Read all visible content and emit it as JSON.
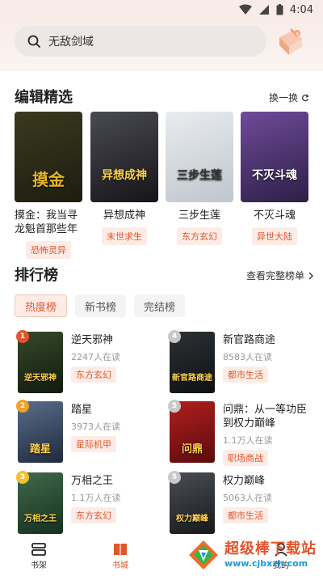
{
  "status": {
    "time": "4:04"
  },
  "search": {
    "query": "无敌剑域"
  },
  "editor_picks": {
    "title": "编辑精选",
    "refresh_label": "换一换",
    "books": [
      {
        "name": "摸金：我当寻龙魁首那些年",
        "tag": "恐怖灵异",
        "cover_text": "摸金",
        "colors": [
          "#3b3a1f",
          "#1d1c10"
        ],
        "accent": "#e8b623"
      },
      {
        "name": "异想成神",
        "tag": "末世求生",
        "cover_text": "异想成神",
        "colors": [
          "#4a4a52",
          "#151519"
        ],
        "accent": "#ffd24a"
      },
      {
        "name": "三步生莲",
        "tag": "东方玄幻",
        "cover_text": "三步生莲",
        "colors": [
          "#e9ecef",
          "#bfc6cc"
        ],
        "accent": "#333333"
      },
      {
        "name": "不灭斗魂",
        "tag": "异世大陆",
        "cover_text": "不灭斗魂",
        "colors": [
          "#6f4a9a",
          "#2d1f46"
        ],
        "accent": "#ffffff"
      }
    ]
  },
  "ranking": {
    "title": "排行榜",
    "view_all_label": "查看完整榜单",
    "tabs": [
      "热度榜",
      "新书榜",
      "完结榜"
    ],
    "active_tab": 0,
    "items": [
      {
        "rank": "1",
        "title": "逆天邪神",
        "readers": "2247人在读",
        "tag": "东方玄幻",
        "cover_text": "逆天邪神",
        "colors": [
          "#354a2a",
          "#121a0e"
        ],
        "badge": "#e2552b"
      },
      {
        "rank": "4",
        "title": "新官路商途",
        "readers": "8583人在读",
        "tag": "都市生活",
        "cover_text": "新官路商途",
        "colors": [
          "#2d3236",
          "#0e1012"
        ],
        "badge": "#c9c9c9"
      },
      {
        "rank": "2",
        "title": "踏星",
        "readers": "3973人在读",
        "tag": "星际机甲",
        "cover_text": "踏星",
        "colors": [
          "#5a6d8a",
          "#1f2a3d"
        ],
        "badge": "#f2a02b"
      },
      {
        "rank": "5",
        "title": "问鼎：从一等功臣到权力巅峰",
        "readers": "1.1万人在读",
        "tag": "职场商战",
        "cover_text": "问鼎",
        "colors": [
          "#b21e1e",
          "#5a0c0c"
        ],
        "badge": "#c9c9c9"
      },
      {
        "rank": "3",
        "title": "万相之王",
        "readers": "1.1万人在读",
        "tag": "东方玄幻",
        "cover_text": "万相之王",
        "colors": [
          "#3f6a4a",
          "#173020"
        ],
        "badge": "#f2c12b"
      },
      {
        "rank": "5",
        "title": "权力巅峰",
        "readers": "5063人在读",
        "tag": "都市生活",
        "cover_text": "权力巅峰",
        "colors": [
          "#4b4f55",
          "#16181b"
        ],
        "badge": "#c9c9c9"
      }
    ]
  },
  "bottom_nav": {
    "items": [
      {
        "label": "书架",
        "icon": "bookshelf-icon"
      },
      {
        "label": "书城",
        "icon": "bookstore-icon"
      },
      {
        "label": "我的",
        "icon": "profile-icon"
      }
    ],
    "active": 1
  },
  "watermark": {
    "name": "超级棒下载站",
    "url": "www.cjbxzh.com"
  },
  "colors": {
    "accent": "#e2552b",
    "tag_bg": "#fdece6"
  }
}
